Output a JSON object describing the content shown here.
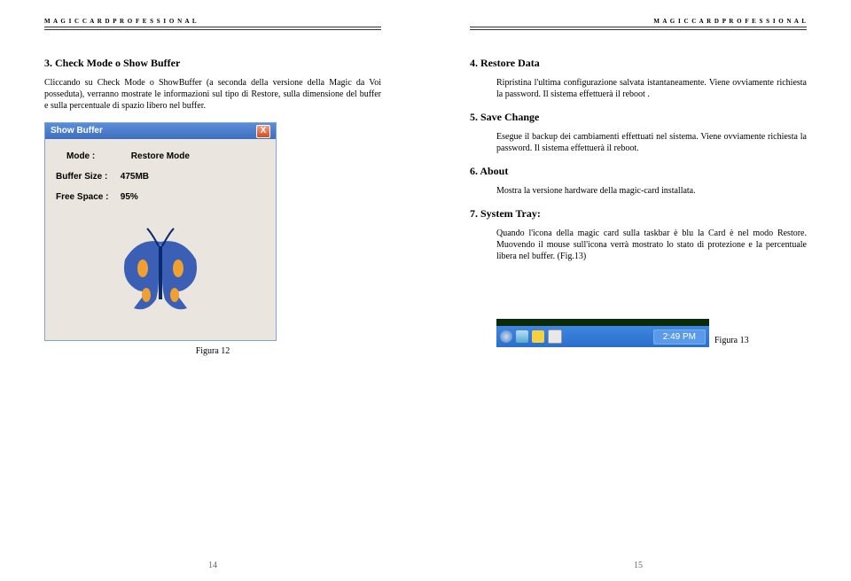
{
  "header": "M A G I C   C A R D   P R O F E S S I O N A L",
  "left": {
    "h3": "3. Check Mode o Show Buffer",
    "p3": "Cliccando su Check Mode o ShowBuffer (a seconda della versione della Magic da Voi posseduta), verranno mostrate le informazioni sul tipo di Restore, sulla dimensione del buffer e sulla percentuale di spazio libero nel buffer.",
    "sb": {
      "title": "Show Buffer",
      "modeLabel": "Mode :",
      "modeValue": "Restore Mode",
      "sizeLabel": "Buffer Size :",
      "sizeValue": "475MB",
      "freeLabel": "Free Space :",
      "freeValue": "95%"
    },
    "fig": "Figura 12",
    "num": "14"
  },
  "right": {
    "h4": "4. Restore Data",
    "p4": "Ripristina l'ultima configurazione salvata istantaneamente. Viene ovviamente richiesta la password. Il sistema effettuerà il reboot .",
    "h5": "5. Save Change",
    "p5": "Esegue il backup dei cambiamenti effettuati nel sistema. Viene ovviamente richiesta la password. Il sistema effettuerà il reboot.",
    "h6": "6. About",
    "p6": "Mostra la versione hardware della magic-card installata.",
    "h7": "7. System Tray:",
    "p7": "Quando l'icona della magic card sulla taskbar è blu la Card è nel modo Restore. Muovendo il mouse sull'icona verrà mostrato lo stato di protezione e la percentuale libera nel buffer. (Fig.13)",
    "clock": "2:49 PM",
    "fig": "Figura 13",
    "num": "15"
  }
}
